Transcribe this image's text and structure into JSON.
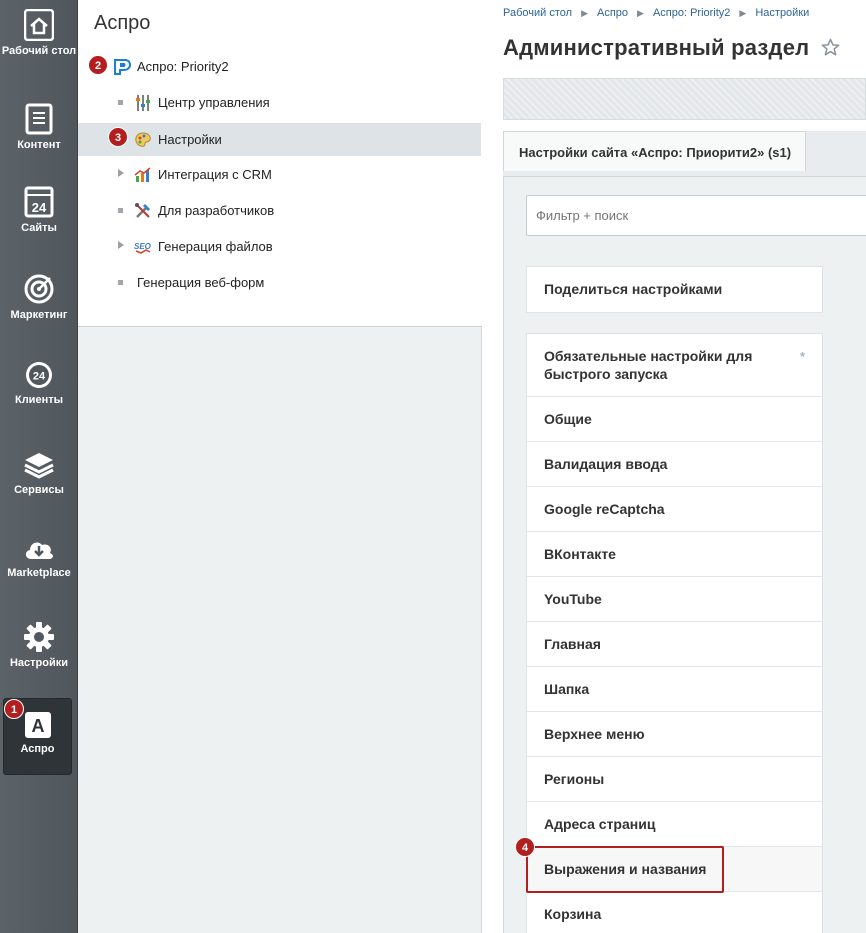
{
  "leftbar": {
    "items": [
      {
        "label": "Рабочий стол",
        "icon": "home-icon"
      },
      {
        "label": "Контент",
        "icon": "document-icon"
      },
      {
        "label": "Сайты",
        "icon": "calendar-24-icon"
      },
      {
        "label": "Маркетинг",
        "icon": "target-icon"
      },
      {
        "label": "Клиенты",
        "icon": "clients-24-icon"
      },
      {
        "label": "Сервисы",
        "icon": "layers-icon"
      },
      {
        "label": "Marketplace",
        "icon": "cloud-download-icon"
      },
      {
        "label": "Настройки",
        "icon": "gear-icon"
      },
      {
        "label": "Аспро",
        "icon": "aspro-a-icon"
      }
    ]
  },
  "menu": {
    "title": "Аспро",
    "items": [
      {
        "label": "Аспро: Priority2",
        "icon": "priority-logo-icon"
      },
      {
        "label": "Центр управления",
        "icon": "control-center-icon"
      },
      {
        "label": "Настройки",
        "icon": "palette-icon"
      },
      {
        "label": "Интеграция с CRM",
        "icon": "crm-chart-icon"
      },
      {
        "label": "Для разработчиков",
        "icon": "tools-icon"
      },
      {
        "label": "Генерация файлов",
        "icon": "seo-icon"
      },
      {
        "label": "Генерация веб-форм",
        "icon": ""
      }
    ]
  },
  "badges": [
    "1",
    "2",
    "3",
    "4"
  ],
  "content": {
    "breadcrumbs": [
      "Рабочий стол",
      "Аспро",
      "Аспро: Priority2",
      "Настройки"
    ],
    "title": "Административный раздел",
    "tab_label": "Настройки сайта «Аспро: Приорити2» (s1)",
    "search_placeholder": "Фильтр + поиск",
    "share_label": "Поделиться настройками",
    "sections": [
      {
        "label": "Обязательные настройки для быстрого запуска",
        "required_mark": "*"
      },
      {
        "label": "Общие"
      },
      {
        "label": "Валидация ввода"
      },
      {
        "label": "Google reCaptcha"
      },
      {
        "label": "ВКонтакте"
      },
      {
        "label": "YouTube"
      },
      {
        "label": "Главная"
      },
      {
        "label": "Шапка"
      },
      {
        "label": "Верхнее меню"
      },
      {
        "label": "Регионы"
      },
      {
        "label": "Адреса страниц"
      },
      {
        "label": "Выражения и названия"
      },
      {
        "label": "Корзина"
      }
    ]
  },
  "colors": {
    "badge": "#b31e1e",
    "link": "#2c6496",
    "sidebar": "#545b61"
  }
}
